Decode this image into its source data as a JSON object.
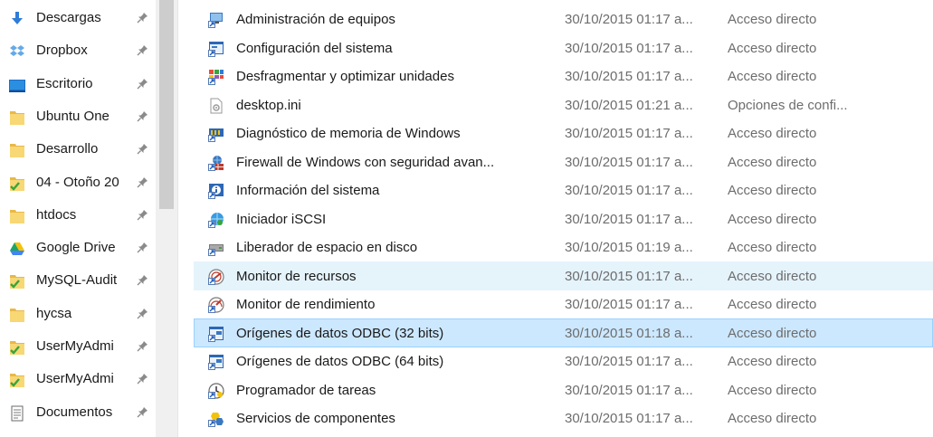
{
  "sidebar": {
    "items": [
      {
        "label": "Descargas",
        "icon": "download-arrow-icon",
        "name": "sidebar-item-descargas"
      },
      {
        "label": "Dropbox",
        "icon": "dropbox-icon",
        "name": "sidebar-item-dropbox"
      },
      {
        "label": "Escritorio",
        "icon": "desktop-icon",
        "name": "sidebar-item-escritorio"
      },
      {
        "label": "Ubuntu One",
        "icon": "folder-icon",
        "name": "sidebar-item-ubuntu-one"
      },
      {
        "label": "Desarrollo",
        "icon": "folder-icon",
        "name": "sidebar-item-desarrollo"
      },
      {
        "label": "04 - Otoño 20",
        "icon": "synced-folder-icon",
        "name": "sidebar-item-otono"
      },
      {
        "label": "htdocs",
        "icon": "folder-icon",
        "name": "sidebar-item-htdocs"
      },
      {
        "label": "Google Drive",
        "icon": "google-drive-icon",
        "name": "sidebar-item-google-drive"
      },
      {
        "label": "MySQL-Audit",
        "icon": "synced-folder-icon",
        "name": "sidebar-item-mysql-audit"
      },
      {
        "label": "hycsa",
        "icon": "folder-icon",
        "name": "sidebar-item-hycsa"
      },
      {
        "label": "UserMyAdmi",
        "icon": "synced-folder-icon",
        "name": "sidebar-item-usermyadmi-1"
      },
      {
        "label": "UserMyAdmi",
        "icon": "synced-folder-icon",
        "name": "sidebar-item-usermyadmi-2"
      },
      {
        "label": "Documentos",
        "icon": "documents-icon",
        "name": "sidebar-item-documentos"
      }
    ]
  },
  "files": [
    {
      "name": "Administración de equipos",
      "date": "30/10/2015 01:17 a...",
      "type": "Acceso directo",
      "icon": "computer-management-icon",
      "state": ""
    },
    {
      "name": "Configuración del sistema",
      "date": "30/10/2015 01:17 a...",
      "type": "Acceso directo",
      "icon": "system-config-icon",
      "state": ""
    },
    {
      "name": "Desfragmentar y optimizar unidades",
      "date": "30/10/2015 01:17 a...",
      "type": "Acceso directo",
      "icon": "defrag-icon",
      "state": ""
    },
    {
      "name": "desktop.ini",
      "date": "30/10/2015 01:21 a...",
      "type": "Opciones de confi...",
      "icon": "settings-file-icon",
      "state": ""
    },
    {
      "name": "Diagnóstico de memoria de Windows",
      "date": "30/10/2015 01:17 a...",
      "type": "Acceso directo",
      "icon": "memory-diagnostic-icon",
      "state": ""
    },
    {
      "name": "Firewall de Windows con seguridad avan...",
      "date": "30/10/2015 01:17 a...",
      "type": "Acceso directo",
      "icon": "firewall-icon",
      "state": ""
    },
    {
      "name": "Información del sistema",
      "date": "30/10/2015 01:17 a...",
      "type": "Acceso directo",
      "icon": "system-info-icon",
      "state": ""
    },
    {
      "name": "Iniciador iSCSI",
      "date": "30/10/2015 01:17 a...",
      "type": "Acceso directo",
      "icon": "iscsi-icon",
      "state": ""
    },
    {
      "name": "Liberador de espacio en disco",
      "date": "30/10/2015 01:19 a...",
      "type": "Acceso directo",
      "icon": "disk-cleanup-icon",
      "state": ""
    },
    {
      "name": "Monitor de recursos",
      "date": "30/10/2015 01:17 a...",
      "type": "Acceso directo",
      "icon": "resource-monitor-icon",
      "state": "hover"
    },
    {
      "name": "Monitor de rendimiento",
      "date": "30/10/2015 01:17 a...",
      "type": "Acceso directo",
      "icon": "performance-monitor-icon",
      "state": ""
    },
    {
      "name": "Orígenes de datos ODBC (32 bits)",
      "date": "30/10/2015 01:18 a...",
      "type": "Acceso directo",
      "icon": "odbc-icon",
      "state": "selected"
    },
    {
      "name": "Orígenes de datos ODBC (64 bits)",
      "date": "30/10/2015 01:17 a...",
      "type": "Acceso directo",
      "icon": "odbc-icon",
      "state": ""
    },
    {
      "name": "Programador de tareas",
      "date": "30/10/2015 01:17 a...",
      "type": "Acceso directo",
      "icon": "task-scheduler-icon",
      "state": ""
    },
    {
      "name": "Servicios de componentes",
      "date": "30/10/2015 01:17 a...",
      "type": "Acceso directo",
      "icon": "component-services-icon",
      "state": ""
    }
  ],
  "colors": {
    "folder": "#f8d775",
    "folder_dark": "#e8b84a",
    "sync_green": "#3aa43a",
    "selected_bg": "#cce8ff",
    "selected_border": "#99d1ff",
    "hover_bg": "#e5f3fb",
    "secondary_text": "#6d6d6d",
    "pin": "#8a8a8a"
  }
}
